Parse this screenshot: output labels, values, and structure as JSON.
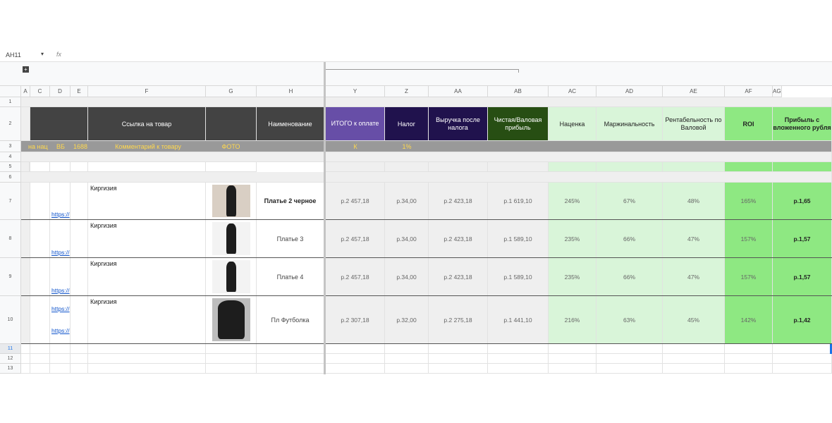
{
  "formula_bar": {
    "name_box": "AH11",
    "fx": "fx"
  },
  "columns": [
    "A",
    "C",
    "D",
    "E",
    "F",
    "G",
    "H",
    "Y",
    "Z",
    "AA",
    "AB",
    "AC",
    "AD",
    "AE",
    "AF",
    "AG"
  ],
  "row_numbers": [
    "1",
    "2",
    "3",
    "4",
    "5",
    "6",
    "7",
    "8",
    "9",
    "10",
    "11",
    "12",
    "13"
  ],
  "header": {
    "link": "Ссылка на товар",
    "name": "Наименование",
    "total": "ИТОГО к оплате",
    "tax": "Налог",
    "revenue": "Выручка после налога",
    "profit": "Чистая/Валовая прибыль",
    "markup": "Наценка",
    "margin": "Маржинальность",
    "profitability": "Рентабельность по Валовой",
    "roi": "ROI",
    "profit_per_ruble": "Прибыль с вложенного рубля"
  },
  "row3": {
    "c1": "на нац",
    "c2": "ВБ",
    "c3": "1688",
    "comment": "Комментарий к товару",
    "photo": "ФОТО",
    "total": "К",
    "tax": "1%"
  },
  "products": [
    {
      "links": [
        "https://"
      ],
      "comment": "Киргизия",
      "name": "Платье 2 черное",
      "total": "р.2 457,18",
      "tax": "р.34,00",
      "revenue": "р.2 423,18",
      "profit": "р.1 619,10",
      "markup": "245%",
      "margin": "67%",
      "profitability": "48%",
      "roi": "165%",
      "ppr": "р.1,65"
    },
    {
      "links": [
        "https://"
      ],
      "comment": "Киргизия",
      "name": "Платье 3",
      "total": "р.2 457,18",
      "tax": "р.34,00",
      "revenue": "р.2 423,18",
      "profit": "р.1 589,10",
      "markup": "235%",
      "margin": "66%",
      "profitability": "47%",
      "roi": "157%",
      "ppr": "р.1,57"
    },
    {
      "links": [
        "https://"
      ],
      "comment": "Киргизия",
      "name": "Платье 4",
      "total": "р.2 457,18",
      "tax": "р.34,00",
      "revenue": "р.2 423,18",
      "profit": "р.1 589,10",
      "markup": "235%",
      "margin": "66%",
      "profitability": "47%",
      "roi": "157%",
      "ppr": "р.1,57"
    },
    {
      "links": [
        "https://",
        "https://"
      ],
      "comment": "Киргизия",
      "name": "Пл Футболка",
      "total": "р.2 307,18",
      "tax": "р.32,00",
      "revenue": "р.2 275,18",
      "profit": "р.1 441,10",
      "markup": "216%",
      "margin": "63%",
      "profitability": "45%",
      "roi": "142%",
      "ppr": "р.1,42"
    }
  ]
}
